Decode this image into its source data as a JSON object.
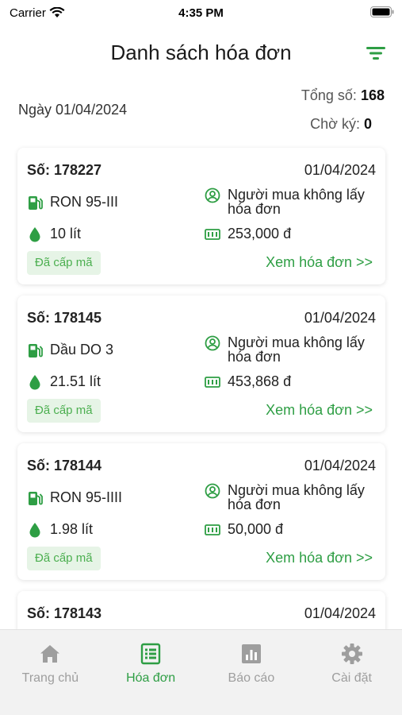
{
  "status_bar": {
    "carrier": "Carrier",
    "time": "4:35 PM"
  },
  "header": {
    "title": "Danh sách hóa đơn"
  },
  "summary": {
    "date_label": "Ngày 01/04/2024",
    "total_label": "Tổng số:",
    "total_value": "168",
    "pending_label": "Chờ ký:",
    "pending_value": "0"
  },
  "invoices": [
    {
      "number": "Số: 178227",
      "date": "01/04/2024",
      "fuel": "RON 95-III",
      "buyer": "Người mua không lấy hóa đơn",
      "quantity": "10 lít",
      "amount": "253,000 đ",
      "status": "Đã cấp mã",
      "view_label": "Xem hóa đơn >>"
    },
    {
      "number": "Số: 178145",
      "date": "01/04/2024",
      "fuel": "Dầu DO 3",
      "buyer": "Người mua không lấy hóa đơn",
      "quantity": "21.51 lít",
      "amount": "453,868 đ",
      "status": "Đã cấp mã",
      "view_label": "Xem hóa đơn >>"
    },
    {
      "number": "Số: 178144",
      "date": "01/04/2024",
      "fuel": "RON 95-IIII",
      "buyer": "Người mua không lấy hóa đơn",
      "quantity": "1.98 lít",
      "amount": "50,000 đ",
      "status": "Đã cấp mã",
      "view_label": "Xem hóa đơn >>"
    },
    {
      "number": "Số: 178143",
      "date": "01/04/2024"
    }
  ],
  "tabs": [
    {
      "label": "Trang chủ",
      "icon": "home-icon",
      "active": false
    },
    {
      "label": "Hóa đơn",
      "icon": "invoice-list-icon",
      "active": true
    },
    {
      "label": "Báo cáo",
      "icon": "report-chart-icon",
      "active": false
    },
    {
      "label": "Cài đặt",
      "icon": "gear-icon",
      "active": false
    }
  ],
  "colors": {
    "accent": "#2e9e44",
    "badge_bg": "#e6f4e6",
    "inactive": "#9e9e9e"
  }
}
